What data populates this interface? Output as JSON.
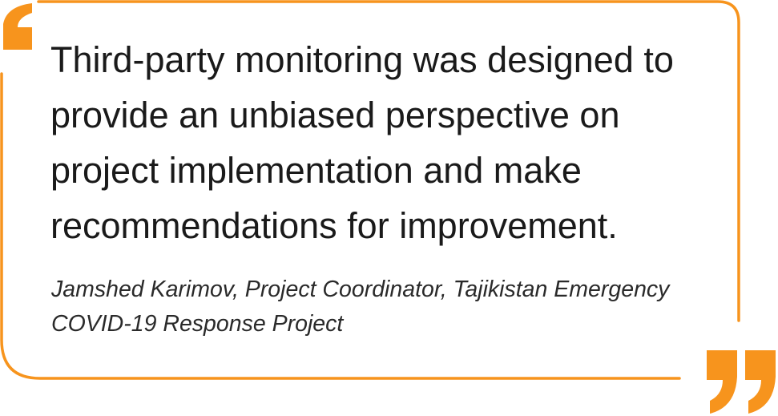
{
  "quote": {
    "text": "Third-party monitoring was designed to provide an unbiased perspective on project implementation and make recommendations for improvement.",
    "attribution": "Jamshed Karimov, Project Coordinator, Tajikistan Emergency COVID-19 Response Project"
  },
  "colors": {
    "accent": "#F7941D",
    "text": "#1a1a1a"
  },
  "icons": {
    "open_quote": "open-quote-mark",
    "close_quote": "close-quote-mark"
  }
}
